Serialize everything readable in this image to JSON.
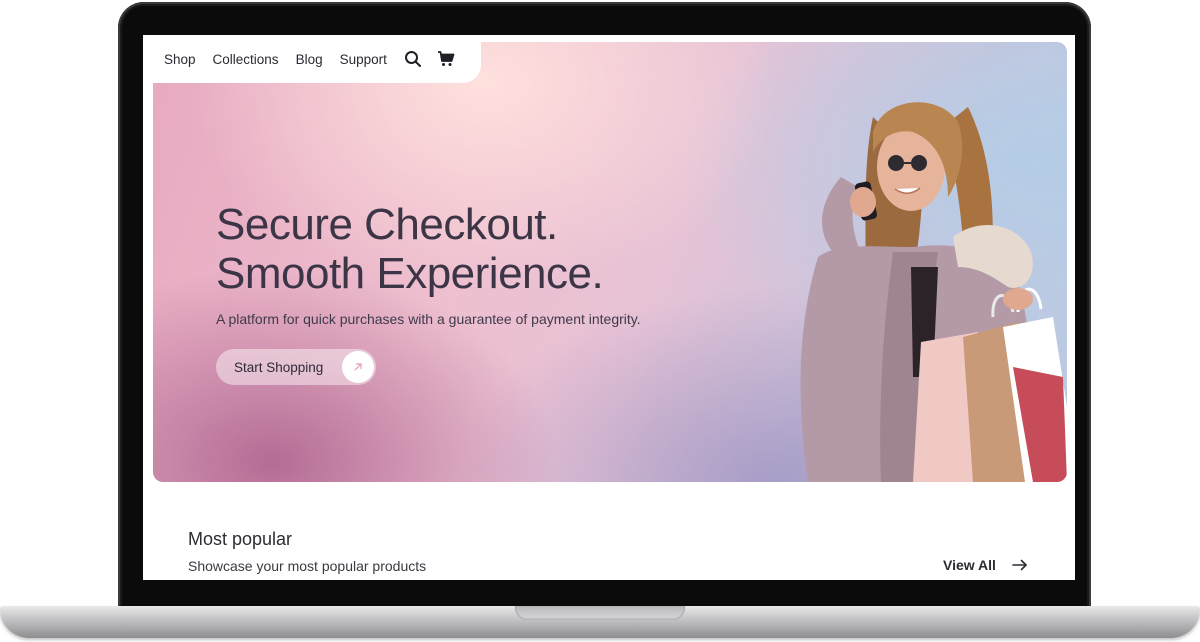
{
  "nav": {
    "items": [
      "Shop",
      "Collections",
      "Blog",
      "Support"
    ],
    "icons": [
      "search-icon",
      "cart-icon"
    ]
  },
  "hero": {
    "headline": "Secure Checkout.\nSmooth Experience.",
    "subtitle": "A platform for quick purchases with a guarantee of payment integrity.",
    "cta_label": "Start Shopping",
    "cta_icon": "arrow-up-right-icon"
  },
  "popular": {
    "title": "Most popular",
    "subtitle": "Showcase your most popular products",
    "view_all_label": "View All",
    "view_all_icon": "arrow-right-icon"
  },
  "colors": {
    "text_dark": "#3b3546",
    "hero_pink": "#eebfcf",
    "hero_blue": "#b8cbe4",
    "cta_accent": "#e79bb4"
  }
}
